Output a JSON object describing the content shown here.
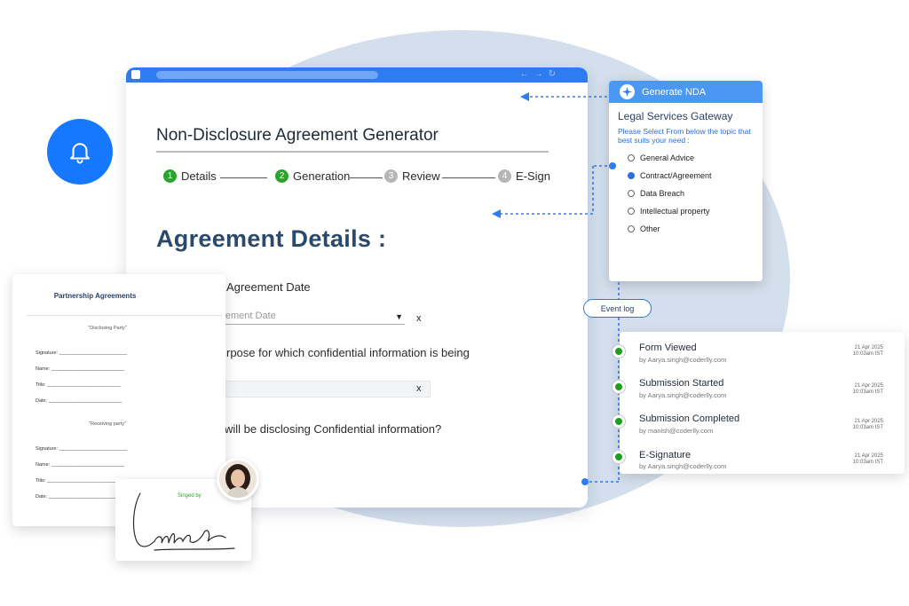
{
  "colors": {
    "brand_blue": "#2f7bf0",
    "step_done": "#2aa52a",
    "step_pending": "#b6b6b6",
    "heading": "#2a4a6d",
    "event_dot": "#1e9e1e"
  },
  "icons": {
    "bell": "bell-icon",
    "sparkle": "sparkle-icon"
  },
  "generator": {
    "title": "Non-Disclosure Agreement Generator",
    "steps": [
      {
        "number": "1",
        "label": "Details",
        "state": "done"
      },
      {
        "number": "2",
        "label": "Generation",
        "state": "done"
      },
      {
        "number": "3",
        "label": "Review",
        "state": "pending"
      },
      {
        "number": "4",
        "label": "E-Sign",
        "state": "pending"
      }
    ],
    "section_title": "Agreement Details :",
    "agreement_date_label": "Agreement Date",
    "agreement_date_placeholder": "greement Date",
    "clear_label": "x",
    "purpose_label": "rpose for which confidential information is being",
    "disclosing_label": "will be disclosing Confidential information?"
  },
  "partnership": {
    "title": "Partnership Agreements",
    "disclosing_party": "\"Disclosing Party\"",
    "receiving_party": "\"Receiving party\"",
    "fields": {
      "signature": "Signature: _________________________",
      "name": "Name: ___________________________",
      "title": "Title: ___________________________",
      "date": "Date: ___________________________"
    }
  },
  "signature_card": {
    "label": "Singed by"
  },
  "nda_panel": {
    "header": "Generate NDA",
    "title": "Legal Services Gateway",
    "description": "Please Select From below the topic that best suits your need :",
    "options": [
      {
        "label": "General Advice",
        "selected": false
      },
      {
        "label": "Contract/Agreement",
        "selected": true
      },
      {
        "label": "Data Breach",
        "selected": false
      },
      {
        "label": "Intellectual property",
        "selected": false
      },
      {
        "label": "Other",
        "selected": false
      }
    ]
  },
  "event_log": {
    "label": "Event log",
    "events": [
      {
        "title": "Form Viewed",
        "by": "by Aarya.singh@coderlly.com",
        "date": "21 Apr 2025",
        "time": "10:03am IST"
      },
      {
        "title": "Submission Started",
        "by": "by Aarya.singh@coderlly.com",
        "date": "21 Apr 2025",
        "time": "10:03am IST"
      },
      {
        "title": "Submission Completed",
        "by": "by manish@coderlly.com",
        "date": "21 Apr 2025",
        "time": "10:03am IST"
      },
      {
        "title": "E-Signature",
        "by": "by Aarya.singh@coderlly.com",
        "date": "21 Apr 2025",
        "time": "10:03am IST"
      }
    ]
  }
}
